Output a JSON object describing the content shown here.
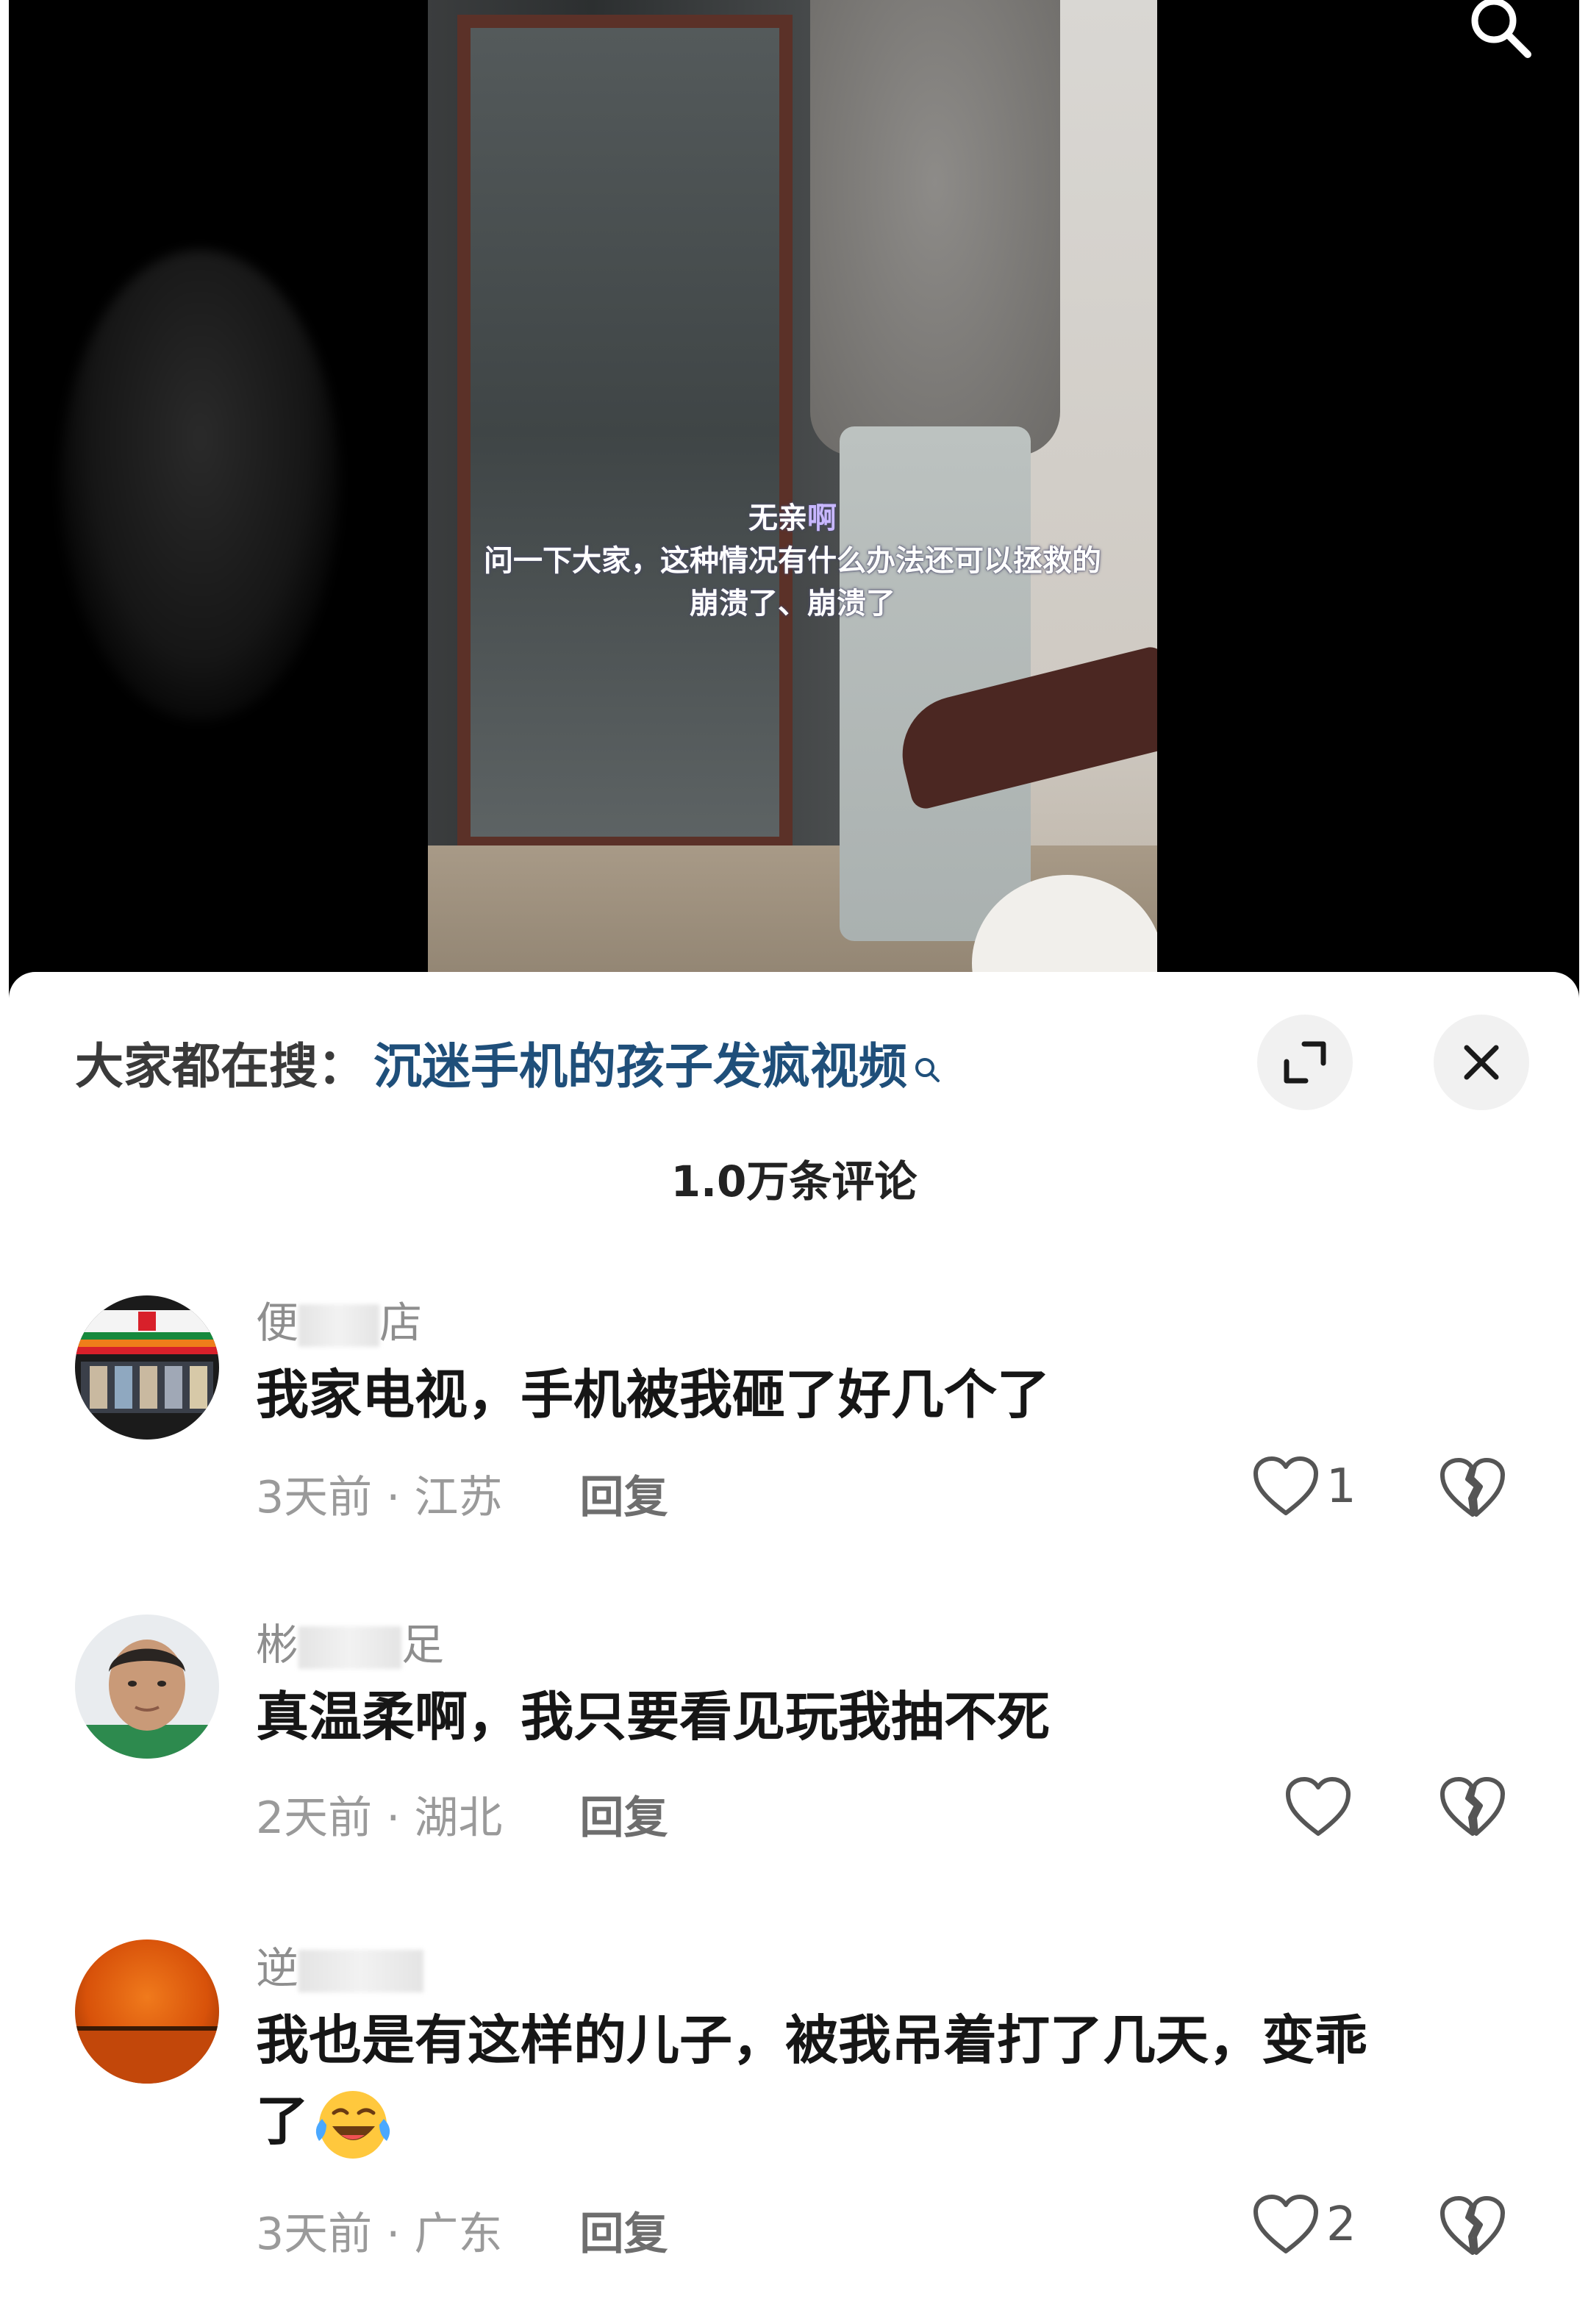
{
  "video": {
    "subtitle_line1_plain": "无亲",
    "subtitle_line1_highlight": "啊",
    "subtitle_line2": "问一下大家，这种情况有什么办法还可以拯救的",
    "subtitle_line3": "崩溃了、崩溃了"
  },
  "sheet": {
    "search_prefix": "大家都在搜：",
    "search_term": "沉迷手机的孩子发疯视频",
    "comment_count": "1.0万条评论"
  },
  "comments": [
    {
      "name_start": "便",
      "name_end": "店",
      "text": "我家电视，手机被我砸了好几个了",
      "time": "3天前",
      "region": "江苏",
      "reply": "回复",
      "likes": "1"
    },
    {
      "name_start": "彬",
      "name_end": "足",
      "text": "真温柔啊，我只要看见玩我抽不死",
      "time": "2天前",
      "region": "湖北",
      "reply": "回复",
      "likes": ""
    },
    {
      "name_start": "逆",
      "name_end": "",
      "text_line1": "我也是有这样的儿子，被我吊着打了几天，变乖",
      "text_line2": "了",
      "time": "3天前",
      "region": "广东",
      "reply": "回复",
      "likes": "2"
    }
  ],
  "icons": {
    "search": "search-icon",
    "expand": "expand-icon",
    "close": "close-icon",
    "like": "heart-icon",
    "dislike": "broken-heart-icon",
    "emoji": "laughing-crying-emoji"
  },
  "colors": {
    "search_term": "#1f4f7a",
    "text": "#161616",
    "meta": "#9a9a9a"
  }
}
